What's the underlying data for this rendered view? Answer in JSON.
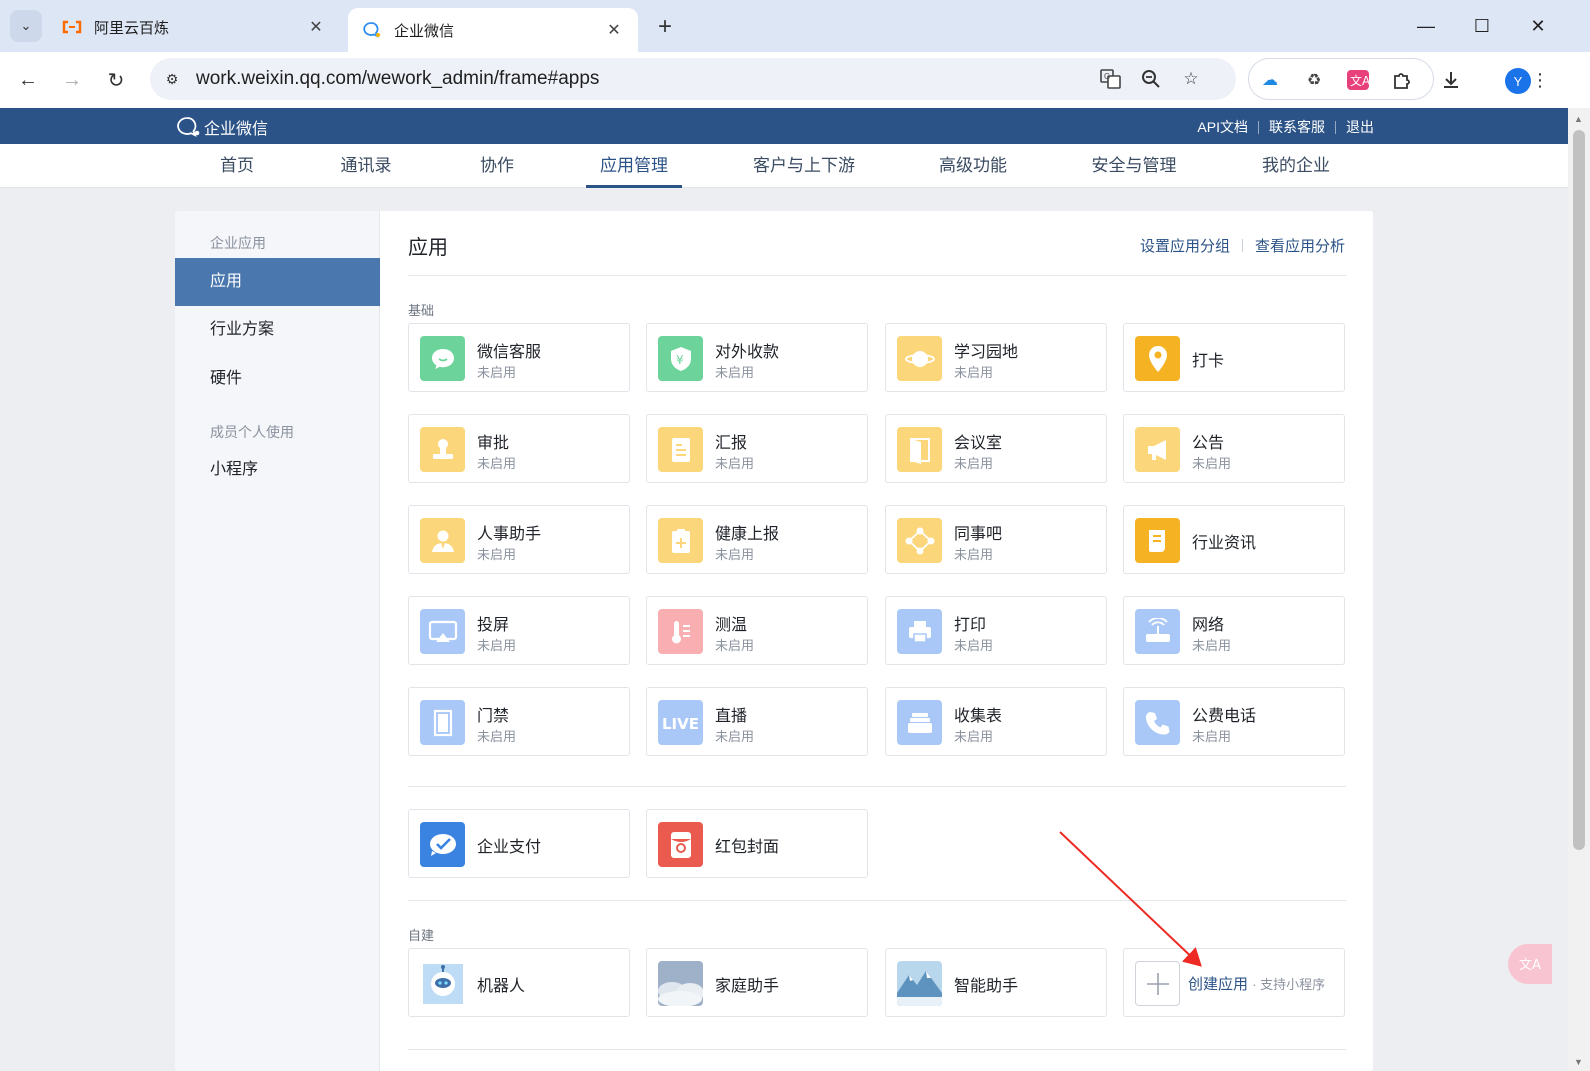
{
  "browser": {
    "tabs": [
      {
        "title": "阿里云百炼",
        "active": false
      },
      {
        "title": "企业微信",
        "active": true
      }
    ],
    "url": "work.weixin.qq.com/wework_admin/frame#apps",
    "profile_initial": "Y"
  },
  "header": {
    "brand": "企业微信",
    "links": [
      "API文档",
      "联系客服",
      "退出"
    ]
  },
  "nav": {
    "items": [
      "首页",
      "通讯录",
      "协作",
      "应用管理",
      "客户与上下游",
      "高级功能",
      "安全与管理",
      "我的企业"
    ],
    "active_index": 3
  },
  "sidebar": {
    "group1": "企业应用",
    "items1": [
      "应用",
      "行业方案",
      "硬件"
    ],
    "group2": "成员个人使用",
    "items2": [
      "小程序"
    ]
  },
  "content": {
    "title": "应用",
    "links": [
      "设置应用分组",
      "查看应用分析"
    ],
    "basic_label": "基础",
    "basic_apps": [
      {
        "name": "微信客服",
        "status": "未启用",
        "icon": "chat-bubble-icon",
        "color": "#6cd49a"
      },
      {
        "name": "对外收款",
        "status": "未启用",
        "icon": "yuan-shield-icon",
        "color": "#6cd49a"
      },
      {
        "name": "学习园地",
        "status": "未启用",
        "icon": "planet-icon",
        "color": "#fbd67a"
      },
      {
        "name": "打卡",
        "status": "",
        "icon": "location-pin-icon",
        "color": "#f5b324"
      },
      {
        "name": "审批",
        "status": "未启用",
        "icon": "stamp-icon",
        "color": "#fbd67a"
      },
      {
        "name": "汇报",
        "status": "未启用",
        "icon": "report-icon",
        "color": "#fbd67a"
      },
      {
        "name": "会议室",
        "status": "未启用",
        "icon": "door-icon",
        "color": "#fbd67a"
      },
      {
        "name": "公告",
        "status": "未启用",
        "icon": "megaphone-icon",
        "color": "#fbd67a"
      },
      {
        "name": "人事助手",
        "status": "未启用",
        "icon": "person-icon",
        "color": "#fbd67a"
      },
      {
        "name": "健康上报",
        "status": "未启用",
        "icon": "clipboard-plus-icon",
        "color": "#fbd67a"
      },
      {
        "name": "同事吧",
        "status": "未启用",
        "icon": "network-nodes-icon",
        "color": "#fbd67a"
      },
      {
        "name": "行业资讯",
        "status": "",
        "icon": "news-icon",
        "color": "#f5b324"
      },
      {
        "name": "投屏",
        "status": "未启用",
        "icon": "cast-icon",
        "color": "#a9c8f7"
      },
      {
        "name": "测温",
        "status": "未启用",
        "icon": "thermometer-icon",
        "color": "#f9aeb1"
      },
      {
        "name": "打印",
        "status": "未启用",
        "icon": "printer-icon",
        "color": "#a9c8f7"
      },
      {
        "name": "网络",
        "status": "未启用",
        "icon": "router-icon",
        "color": "#a9c8f7"
      },
      {
        "name": "门禁",
        "status": "未启用",
        "icon": "gate-icon",
        "color": "#a9c8f7"
      },
      {
        "name": "直播",
        "status": "未启用",
        "icon": "live-icon",
        "color": "#a9c8f7",
        "icon_text": "LIVE"
      },
      {
        "name": "收集表",
        "status": "未启用",
        "icon": "tray-icon",
        "color": "#a9c8f7"
      },
      {
        "name": "公费电话",
        "status": "未启用",
        "icon": "phone-icon",
        "color": "#a9c8f7"
      }
    ],
    "pay_apps": [
      {
        "name": "企业支付",
        "icon": "wechat-pay-icon",
        "color": "#3a83e0"
      },
      {
        "name": "红包封面",
        "icon": "red-packet-icon",
        "color": "#ea5a4e"
      }
    ],
    "custom_label": "自建",
    "custom_apps": [
      {
        "name": "机器人",
        "icon": "robot-icon",
        "color": "#8fc2f0"
      },
      {
        "name": "家庭助手",
        "icon": "cloud-photo-icon",
        "color": "#b9c7d9"
      },
      {
        "name": "智能助手",
        "icon": "mountain-photo-icon",
        "color": "#8ab8d9"
      }
    ],
    "create": {
      "label": "创建应用",
      "sub": "· 支持小程序"
    }
  }
}
